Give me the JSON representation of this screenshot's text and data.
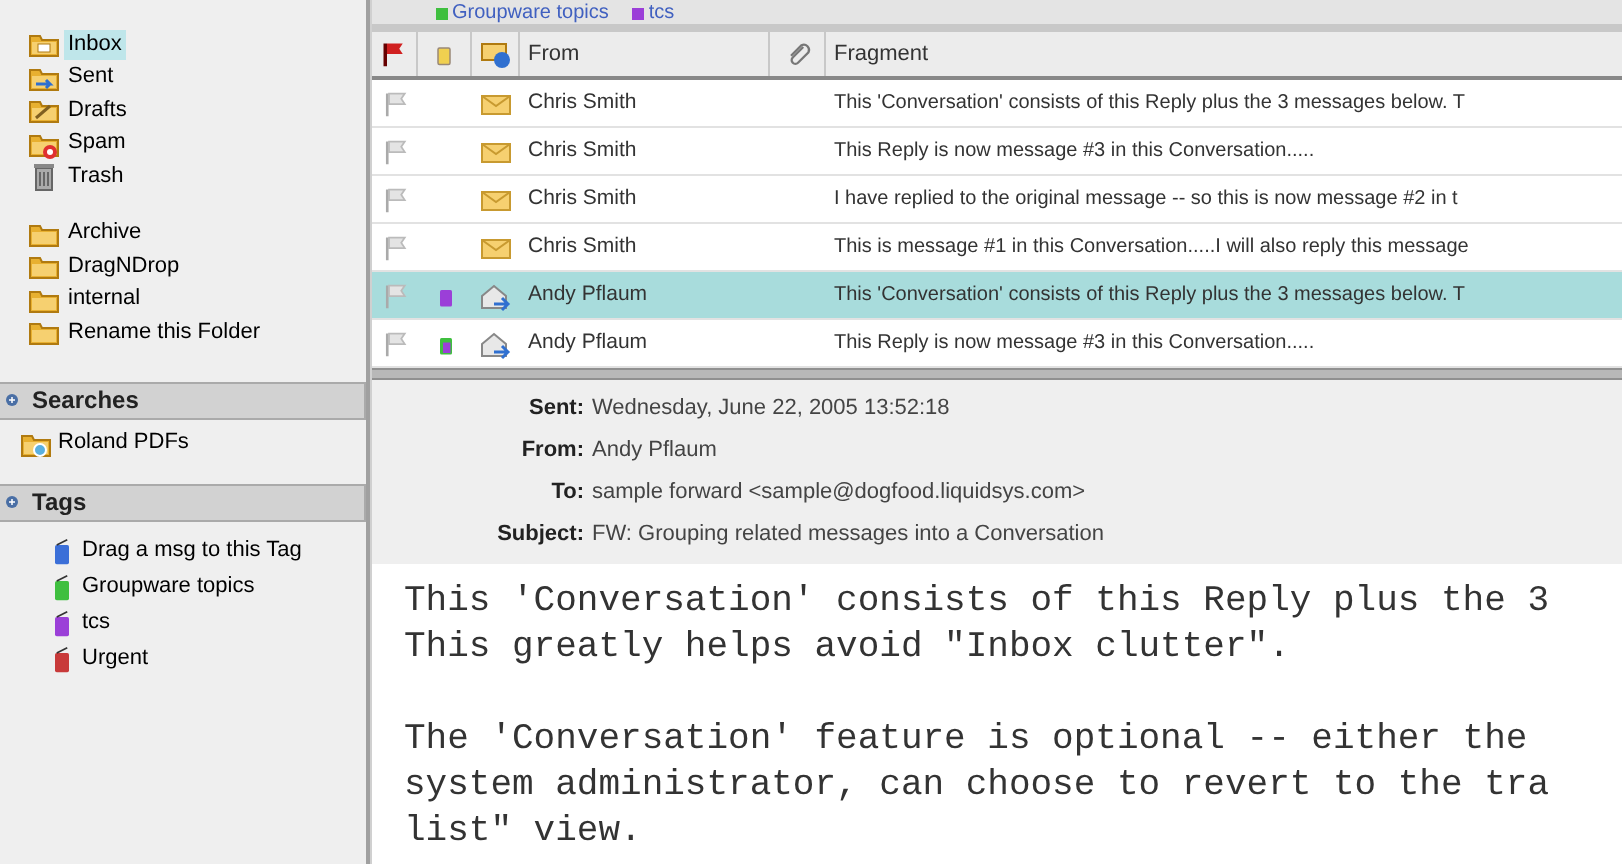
{
  "sidebar": {
    "folder_groups": [
      [
        {
          "label": "Inbox",
          "kind": "inbox",
          "selected": true
        },
        {
          "label": "Sent",
          "kind": "sent",
          "selected": false
        },
        {
          "label": "Drafts",
          "kind": "drafts",
          "selected": false
        },
        {
          "label": "Spam",
          "kind": "spam",
          "selected": false
        },
        {
          "label": "Trash",
          "kind": "trash",
          "selected": false
        }
      ],
      [
        {
          "label": "Archive",
          "kind": "folder",
          "selected": false
        },
        {
          "label": "DragNDrop",
          "kind": "folder",
          "selected": false
        },
        {
          "label": "internal",
          "kind": "folder",
          "selected": false
        },
        {
          "label": "Rename this Folder",
          "kind": "folder",
          "selected": false
        }
      ]
    ],
    "searches": {
      "title": "Searches",
      "items": [
        {
          "label": "Roland PDFs"
        }
      ]
    },
    "tags": {
      "title": "Tags",
      "items": [
        {
          "label": "Drag a msg to this Tag",
          "color": "#3b6fd8"
        },
        {
          "label": "Groupware topics",
          "color": "#3fbf3f"
        },
        {
          "label": "tcs",
          "color": "#9b3fd8"
        },
        {
          "label": "Urgent",
          "color": "#c83a3a"
        }
      ]
    }
  },
  "tag_strip": [
    {
      "label": "Groupware topics",
      "color": "#3fbf3f"
    },
    {
      "label": "tcs",
      "color": "#9b3fd8"
    }
  ],
  "message_list": {
    "columns": [
      "From",
      "Fragment"
    ],
    "rows": [
      {
        "from": "Chris Smith",
        "fragment": "This 'Conversation' consists of this Reply plus the 3 messages below. T",
        "envelope": {
          "kind": "received"
        },
        "selected": false
      },
      {
        "from": "Chris Smith",
        "fragment": "This Reply is now message #3 in this Conversation.....",
        "envelope": {
          "kind": "received"
        },
        "selected": false
      },
      {
        "from": "Chris Smith",
        "fragment": "I have replied to the original message -- so this is now message #2 in t",
        "envelope": {
          "kind": "received"
        },
        "selected": false
      },
      {
        "from": "Chris Smith",
        "fragment": "This is message #1 in this Conversation.....I will also reply this message",
        "envelope": {
          "kind": "received"
        },
        "selected": false
      },
      {
        "from": "Andy Pflaum",
        "fragment": "This 'Conversation' consists of this Reply plus the 3 messages below. T",
        "envelope": {
          "kind": "forwarded"
        },
        "tag": {
          "kind": "single"
        },
        "selected": true
      },
      {
        "from": "Andy Pflaum",
        "fragment": "This Reply is now message #3 in this Conversation.....",
        "envelope": {
          "kind": "forwarded"
        },
        "tag": {
          "kind": "multi"
        },
        "selected": false
      }
    ]
  },
  "message": {
    "headers": [
      {
        "label": "Sent:",
        "value": "Wednesday, June 22, 2005 13:52:18"
      },
      {
        "label": "From:",
        "value": "Andy Pflaum"
      },
      {
        "label": "To:",
        "value": "sample forward <sample@dogfood.liquidsys.com>"
      },
      {
        "label": "Subject:",
        "value": "FW: Grouping related messages into a Conversation"
      }
    ],
    "body": [
      [
        "This 'Conversation' consists of this Reply plus the 3",
        "This greatly helps avoid \"Inbox clutter\"."
      ],
      [
        "The 'Conversation' feature is optional -- either the",
        "system administrator, can choose to revert to the tra",
        "list\" view."
      ]
    ]
  }
}
